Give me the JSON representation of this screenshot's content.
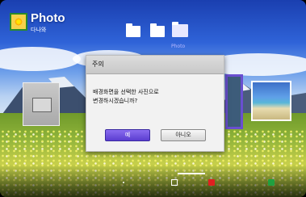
{
  "header": {
    "app_title": "Photo",
    "app_subtitle": "다나와",
    "logo_icon": "photo-app-icon"
  },
  "folder_tabs": [
    {
      "icon": "folder-icon"
    },
    {
      "icon": "folder-icon"
    },
    {
      "icon": "folder-icon",
      "caption": "Photo",
      "active": true
    }
  ],
  "dialog": {
    "title": "주의",
    "message_line1": "배경화면을 선택한 사진으로",
    "message_line2": "변경하시겠습니까?",
    "yes_label": "예",
    "no_label": "아니오"
  },
  "colors": {
    "dialog_yes_button": "#5a3dd0",
    "selection_frame": "#6a4fd0",
    "red_key": "#e02020",
    "green_key": "#20a040"
  }
}
